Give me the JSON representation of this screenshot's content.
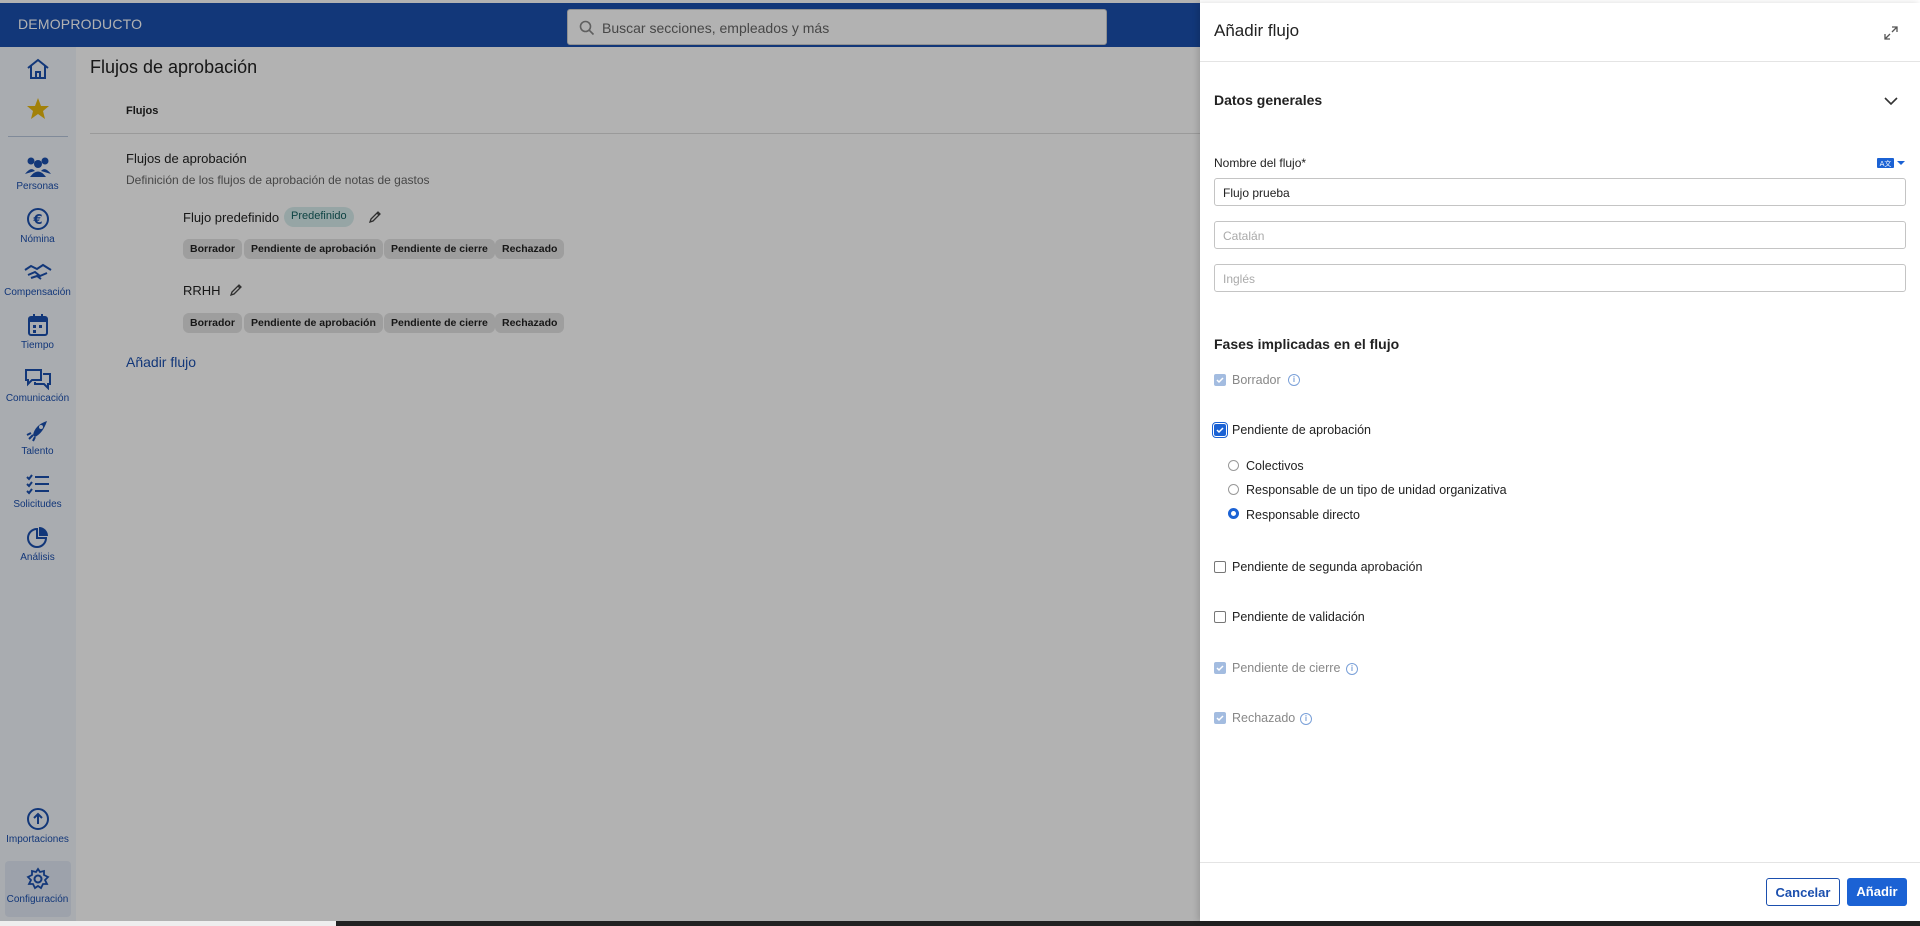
{
  "topbar": {
    "brand": "DEMOPRODUCTO",
    "search_placeholder": "Buscar secciones, empleados y más"
  },
  "sidebar": {
    "items": [
      {
        "label": "Personas",
        "icon": "people-icon"
      },
      {
        "label": "Nómina",
        "icon": "euro-icon"
      },
      {
        "label": "Compensación",
        "icon": "handshake-icon"
      },
      {
        "label": "Tiempo",
        "icon": "calendar-icon"
      },
      {
        "label": "Comunicación",
        "icon": "chat-icon"
      },
      {
        "label": "Talento",
        "icon": "rocket-icon"
      },
      {
        "label": "Solicitudes",
        "icon": "checklist-icon"
      },
      {
        "label": "Análisis",
        "icon": "pie-chart-icon"
      },
      {
        "label": "Importaciones",
        "icon": "upload-icon"
      },
      {
        "label": "Configuración",
        "icon": "gear-icon"
      }
    ]
  },
  "main": {
    "title": "Flujos de aprobación",
    "tab": "Flujos",
    "section_title": "Flujos de aprobación",
    "section_desc": "Definición de los flujos de aprobación de notas de gastos",
    "flows": [
      {
        "name": "Flujo predefinido",
        "badge": "Predefinido",
        "chips": [
          "Borrador",
          "Pendiente de aprobación",
          "Pendiente de cierre",
          "Rechazado"
        ]
      },
      {
        "name": "RRHH",
        "chips": [
          "Borrador",
          "Pendiente de aprobación",
          "Pendiente de cierre",
          "Rechazado"
        ]
      }
    ],
    "add_flow": "Añadir flujo"
  },
  "drawer": {
    "title": "Añadir flujo",
    "section": "Datos generales",
    "name_label": "Nombre del flujo*",
    "name_value": "Flujo prueba",
    "catalan_placeholder": "Catalán",
    "english_placeholder": "Inglés",
    "phases_title": "Fases implicadas en el flujo",
    "phases": {
      "borrador": "Borrador",
      "pend_aprobacion": "Pendiente de aprobación",
      "opt_colectivos": "Colectivos",
      "opt_responsable_tipo": "Responsable de un tipo de unidad organizativa",
      "opt_responsable_directo": "Responsable directo",
      "pend_segunda": "Pendiente de segunda aprobación",
      "pend_validacion": "Pendiente de validación",
      "pend_cierre": "Pendiente de cierre",
      "rechazado": "Rechazado"
    },
    "cancel": "Cancelar",
    "add": "Añadir"
  },
  "colors": {
    "brand": "#1b4fae",
    "accent": "#1b62d4",
    "badge_bg": "#d7ecec"
  }
}
